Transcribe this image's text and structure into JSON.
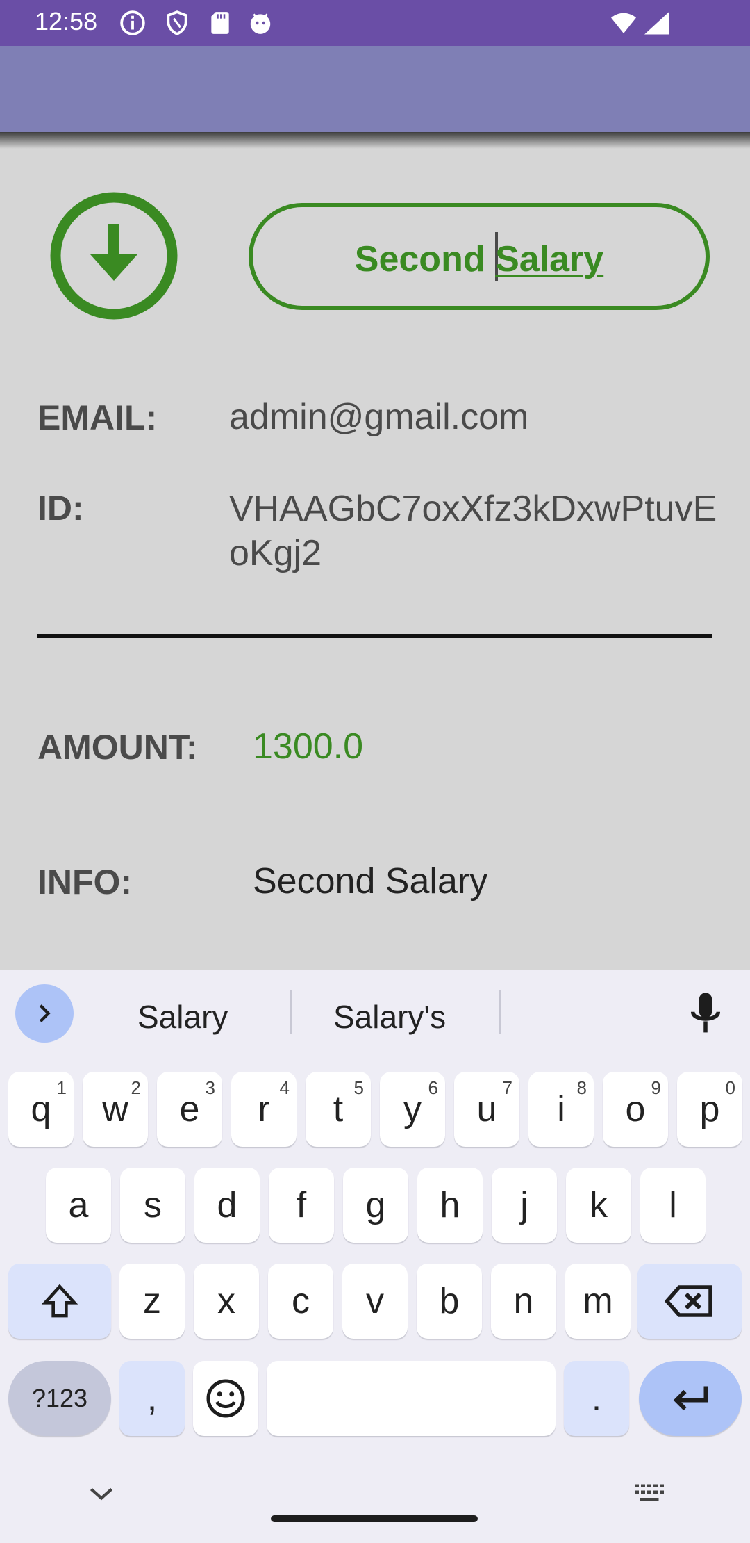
{
  "status_bar": {
    "time": "12:58",
    "icons": [
      "info-icon",
      "shield-icon",
      "sd-card-icon",
      "android-debug-icon",
      "wifi-icon",
      "signal-icon"
    ]
  },
  "colors": {
    "status_bar": "#6a4ea6",
    "app_bar": "#7f7fb5",
    "background": "#d6d6d6",
    "accent_green": "#3a8a22",
    "keyboard_bg": "#eeedf5",
    "keyboard_accent": "#adc3f7"
  },
  "header": {
    "title_word1": "Second",
    "title_word2": "Salary",
    "download_icon": "arrow-down-circle-icon"
  },
  "details": {
    "email_label": "EMAIL:",
    "email_value": "admin@gmail.com",
    "id_label": "ID:",
    "id_value": "VHAAGbC7oxXfz3kDxwPtuvEoKgj2",
    "amount_label": "AMOUNT:",
    "amount_value": "1300.0",
    "info_label": "INFO:",
    "info_value": "Second Salary"
  },
  "keyboard": {
    "suggestions": [
      "Salary",
      "Salary's"
    ],
    "row1": [
      {
        "k": "q",
        "s": "1"
      },
      {
        "k": "w",
        "s": "2"
      },
      {
        "k": "e",
        "s": "3"
      },
      {
        "k": "r",
        "s": "4"
      },
      {
        "k": "t",
        "s": "5"
      },
      {
        "k": "y",
        "s": "6"
      },
      {
        "k": "u",
        "s": "7"
      },
      {
        "k": "i",
        "s": "8"
      },
      {
        "k": "o",
        "s": "9"
      },
      {
        "k": "p",
        "s": "0"
      }
    ],
    "row2": [
      "a",
      "s",
      "d",
      "f",
      "g",
      "h",
      "j",
      "k",
      "l"
    ],
    "row3": [
      "z",
      "x",
      "c",
      "v",
      "b",
      "n",
      "m"
    ],
    "symbols_label": "?123",
    "comma": ",",
    "period": "."
  }
}
